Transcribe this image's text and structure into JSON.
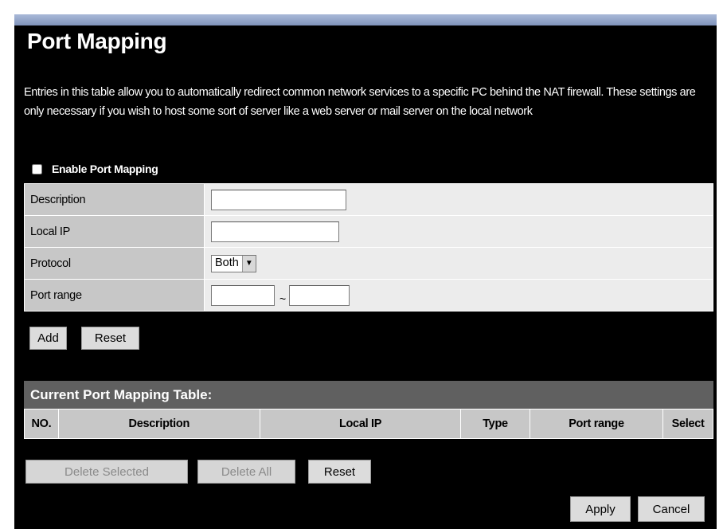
{
  "page_title": "Port Mapping",
  "intro_text": "Entries in this table allow you to automatically redirect common network services to a specific PC behind the NAT firewall. These settings are only necessary if you wish to host some sort of server like a web server or mail server on the local network",
  "enable_label": "Enable Port Mapping",
  "enable_checked": false,
  "form": {
    "description_label": "Description",
    "description_value": "",
    "local_ip_label": "Local IP",
    "local_ip_value": "",
    "protocol_label": "Protocol",
    "protocol_value": "Both",
    "port_range_label": "Port range",
    "port_from": "",
    "port_separator": "~",
    "port_to": ""
  },
  "form_buttons": {
    "add": "Add",
    "reset": "Reset"
  },
  "current_table": {
    "title": "Current Port Mapping Table:",
    "columns": [
      "NO.",
      "Description",
      "Local IP",
      "Type",
      "Port range",
      "Select"
    ],
    "rows": []
  },
  "table_buttons": {
    "delete_selected": "Delete Selected",
    "delete_all": "Delete All",
    "reset": "Reset"
  },
  "footer_buttons": {
    "apply": "Apply",
    "cancel": "Cancel"
  }
}
